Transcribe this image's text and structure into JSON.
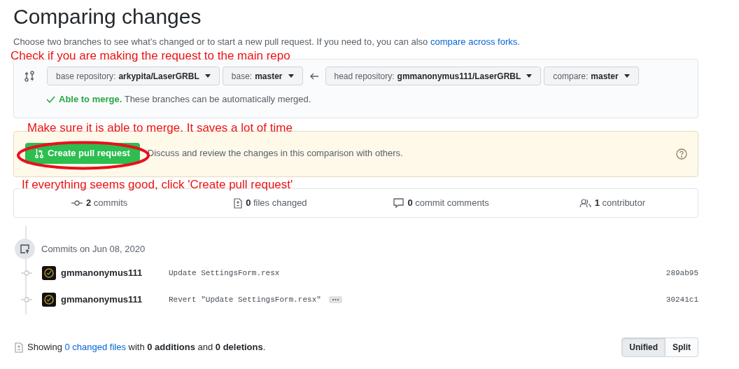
{
  "title": "Comparing changes",
  "subtitle": {
    "text": "Choose two branches to see what’s changed or to start a new pull request. If you need to, you can also ",
    "link": "compare across forks",
    "after": "."
  },
  "annotations": [
    "Check if you are making the request to the main repo",
    "Make sure it is able to merge. It saves a lot of time",
    "If everything seems good, click 'Create pull request'"
  ],
  "compare": {
    "selectors": [
      {
        "label": "base repository:",
        "value": "arkypita/LaserGRBL"
      },
      {
        "label": "base:",
        "value": "master"
      },
      {
        "label": "head repository:",
        "value": "gmmanonymus111/LaserGRBL"
      },
      {
        "label": "compare:",
        "value": "master"
      }
    ],
    "merge_status": {
      "title": "Able to merge.",
      "text": "These branches can be automatically merged."
    }
  },
  "pull_request": {
    "button": "Create pull request",
    "description": "Discuss and review the changes in this comparison with others.",
    "highlighted": true
  },
  "stats": [
    {
      "kind": "commits",
      "count": "2",
      "label": "commits"
    },
    {
      "kind": "files",
      "count": "0",
      "label": "files changed"
    },
    {
      "kind": "comments",
      "count": "0",
      "label": "commit comments"
    },
    {
      "kind": "contributors",
      "count": "1",
      "label": "contributor"
    }
  ],
  "commit_group": {
    "date_label": "Commits on Jun 08, 2020",
    "commits": [
      {
        "author": "gmmanonymus111",
        "message": "Update SettingsForm.resx",
        "sha": "289ab95",
        "has_more": false
      },
      {
        "author": "gmmanonymus111",
        "message": "Revert \"Update SettingsForm.resx\"",
        "sha": "30241c1",
        "has_more": true
      }
    ]
  },
  "summary": {
    "before": "Showing ",
    "link": "0 changed files",
    "after": " with **0 additions** and **0 deletions**."
  },
  "view_toggle": [
    {
      "label": "Unified",
      "selected": true
    },
    {
      "label": "Split",
      "selected": false
    }
  ]
}
